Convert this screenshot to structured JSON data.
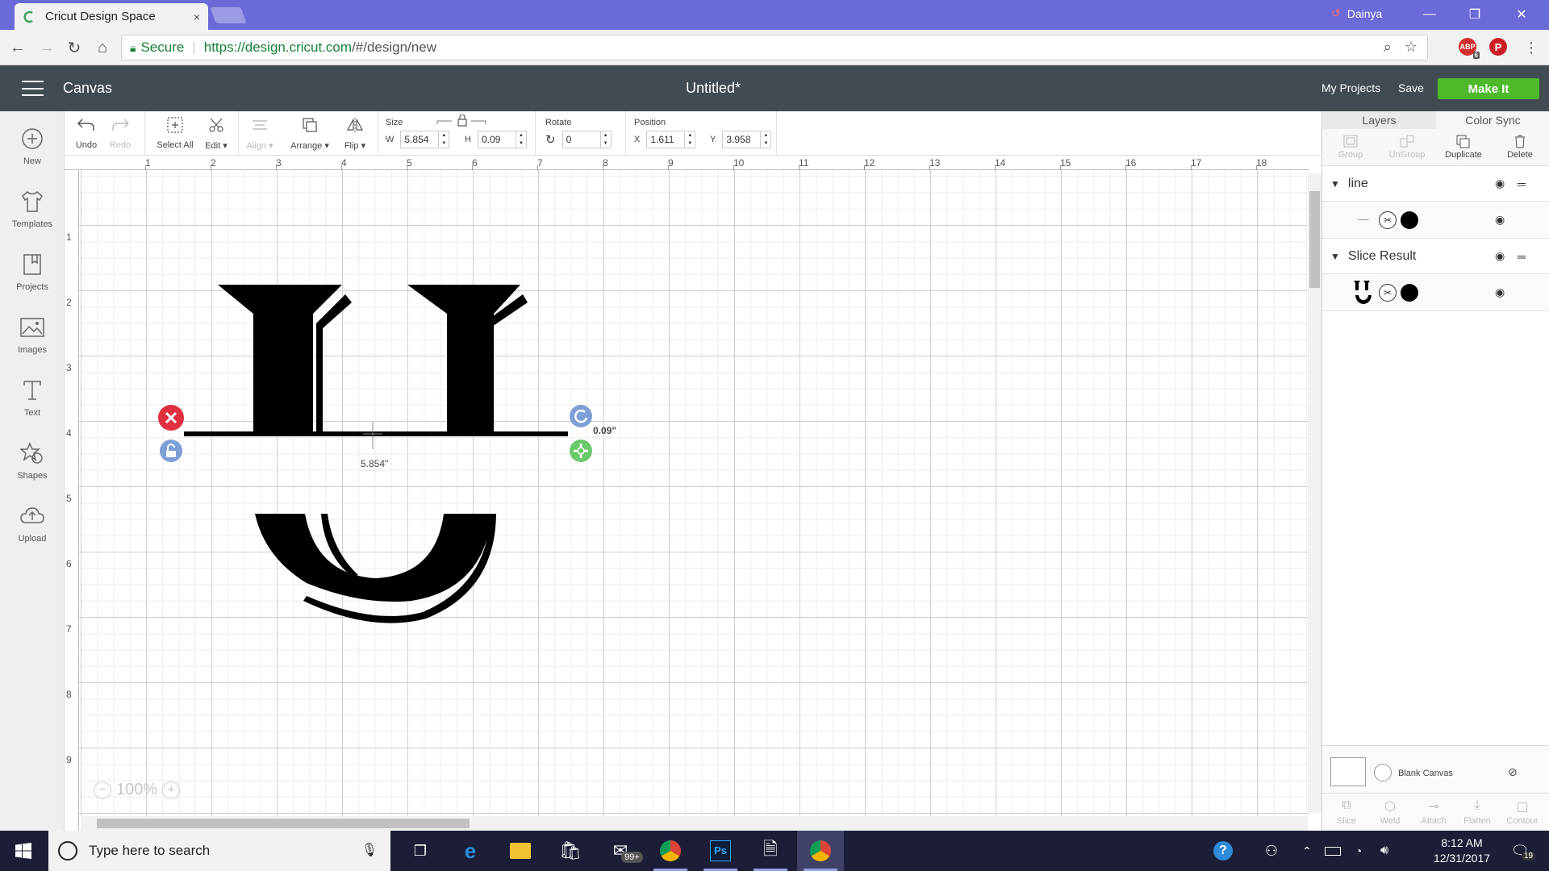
{
  "browser": {
    "tab_title": "Cricut Design Space",
    "close_tab_glyph": "×",
    "user_name": "Dainya",
    "security_label": "Secure",
    "url_host": "https://design.cricut.com",
    "url_path": "/#/design/new",
    "ext_adblock_badge": "6",
    "ext_adblock_label": "ABP",
    "win_min": "—",
    "win_restore": "❐",
    "win_close": "✕"
  },
  "header": {
    "section": "Canvas",
    "doc_title": "Untitled*",
    "my_projects": "My Projects",
    "save": "Save",
    "make_it": "Make It"
  },
  "sidebar": {
    "items": [
      {
        "label": "New",
        "icon": "plus-circle-icon"
      },
      {
        "label": "Templates",
        "icon": "tshirt-icon"
      },
      {
        "label": "Projects",
        "icon": "projects-icon"
      },
      {
        "label": "Images",
        "icon": "image-icon"
      },
      {
        "label": "Text",
        "icon": "text-icon"
      },
      {
        "label": "Shapes",
        "icon": "shapes-icon"
      },
      {
        "label": "Upload",
        "icon": "cloud-upload-icon"
      }
    ]
  },
  "toolbar": {
    "undo": "Undo",
    "redo": "Redo",
    "select_all": "Select All",
    "edit": "Edit",
    "align": "Align",
    "arrange": "Arrange",
    "flip": "Flip",
    "size_label": "Size",
    "w_label": "W",
    "w_value": "5.854",
    "h_label": "H",
    "h_value": "0.09",
    "rotate_label": "Rotate",
    "rotate_value": "0",
    "position_label": "Position",
    "x_label": "X",
    "x_value": "1.611",
    "y_label": "Y",
    "y_value": "3.958"
  },
  "canvas": {
    "ruler_top": [
      "1",
      "2",
      "3",
      "4",
      "5",
      "6",
      "7",
      "8",
      "9",
      "10",
      "11",
      "12",
      "13",
      "14",
      "15",
      "16",
      "17",
      "18"
    ],
    "ruler_left": [
      "1",
      "2",
      "3",
      "4",
      "5",
      "6",
      "7",
      "8",
      "9"
    ],
    "selection_width_label": "5.854\"",
    "selection_height_label": "0.09\"",
    "zoom_level": "100%",
    "zoom_out": "−",
    "zoom_in": "+"
  },
  "layers_panel": {
    "tab_layers": "Layers",
    "tab_color_sync": "Color Sync",
    "tools": {
      "group": "Group",
      "ungroup": "UnGroup",
      "duplicate": "Duplicate",
      "delete": "Delete"
    },
    "layers": [
      {
        "name": "line"
      },
      {
        "name": "Slice Result"
      }
    ],
    "blank_canvas": "Blank Canvas",
    "actions": {
      "slice": "Slice",
      "weld": "Weld",
      "attach": "Attach",
      "flatten": "Flatten",
      "contour": "Contour"
    }
  },
  "taskbar": {
    "search_placeholder": "Type here to search",
    "mail_badge": "99+",
    "time": "8:12 AM",
    "date": "12/31/2017",
    "notification_count": "19",
    "photoshop_label": "Ps"
  },
  "colors": {
    "accent_green": "#4db92b",
    "header_bg": "#414b52",
    "titlebar": "#6b6ad9",
    "delete_handle": "#e0303f",
    "handle_blue": "#7e9fd6",
    "handle_green": "#6bc96b"
  }
}
